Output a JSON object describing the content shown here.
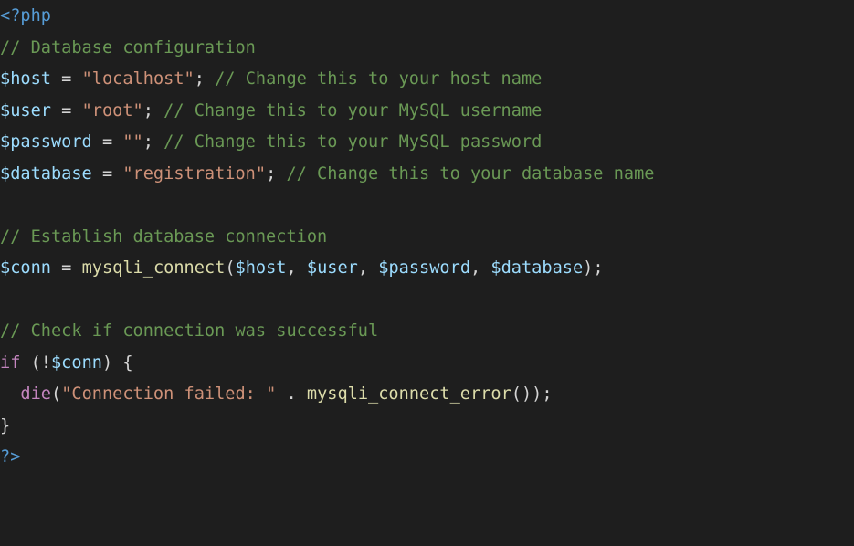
{
  "editor": {
    "language": "php",
    "colors": {
      "background": "#1e1e1e",
      "default": "#d4d4d4",
      "tag": "#569cd6",
      "comment": "#6a9955",
      "variable": "#9cdcfe",
      "string": "#ce9178",
      "function": "#dcdcaa",
      "keyword": "#c586c0"
    },
    "lines": [
      [
        {
          "t": "tag",
          "v": "<?php"
        }
      ],
      [
        {
          "t": "cm",
          "v": "// Database configuration"
        }
      ],
      [
        {
          "t": "var",
          "v": "$host"
        },
        {
          "t": "op",
          "v": " = "
        },
        {
          "t": "str",
          "v": "\"localhost\""
        },
        {
          "t": "punc",
          "v": "; "
        },
        {
          "t": "cm",
          "v": "// Change this to your host name"
        }
      ],
      [
        {
          "t": "var",
          "v": "$user"
        },
        {
          "t": "op",
          "v": " = "
        },
        {
          "t": "str",
          "v": "\"root\""
        },
        {
          "t": "punc",
          "v": "; "
        },
        {
          "t": "cm",
          "v": "// Change this to your MySQL username"
        }
      ],
      [
        {
          "t": "var",
          "v": "$password"
        },
        {
          "t": "op",
          "v": " = "
        },
        {
          "t": "str",
          "v": "\"\""
        },
        {
          "t": "punc",
          "v": "; "
        },
        {
          "t": "cm",
          "v": "// Change this to your MySQL password"
        }
      ],
      [
        {
          "t": "var",
          "v": "$database"
        },
        {
          "t": "op",
          "v": " = "
        },
        {
          "t": "str",
          "v": "\"registration\""
        },
        {
          "t": "punc",
          "v": "; "
        },
        {
          "t": "cm",
          "v": "// Change this to your database name"
        }
      ],
      [],
      [
        {
          "t": "cm",
          "v": "// Establish database connection"
        }
      ],
      [
        {
          "t": "var",
          "v": "$conn"
        },
        {
          "t": "op",
          "v": " = "
        },
        {
          "t": "fn",
          "v": "mysqli_connect"
        },
        {
          "t": "punc",
          "v": "("
        },
        {
          "t": "var",
          "v": "$host"
        },
        {
          "t": "punc",
          "v": ", "
        },
        {
          "t": "var",
          "v": "$user"
        },
        {
          "t": "punc",
          "v": ", "
        },
        {
          "t": "var",
          "v": "$password"
        },
        {
          "t": "punc",
          "v": ", "
        },
        {
          "t": "var",
          "v": "$database"
        },
        {
          "t": "punc",
          "v": ");"
        }
      ],
      [],
      [
        {
          "t": "cm",
          "v": "// Check if connection was successful"
        }
      ],
      [
        {
          "t": "kw",
          "v": "if"
        },
        {
          "t": "punc",
          "v": " (!"
        },
        {
          "t": "var",
          "v": "$conn"
        },
        {
          "t": "punc",
          "v": ") {"
        }
      ],
      [
        {
          "t": "punc",
          "v": "  "
        },
        {
          "t": "kw",
          "v": "die"
        },
        {
          "t": "punc",
          "v": "("
        },
        {
          "t": "str",
          "v": "\"Connection failed: \""
        },
        {
          "t": "op",
          "v": " . "
        },
        {
          "t": "fn",
          "v": "mysqli_connect_error"
        },
        {
          "t": "punc",
          "v": "());"
        }
      ],
      [
        {
          "t": "punc",
          "v": "}"
        }
      ],
      [
        {
          "t": "tag",
          "v": "?>"
        }
      ]
    ]
  }
}
